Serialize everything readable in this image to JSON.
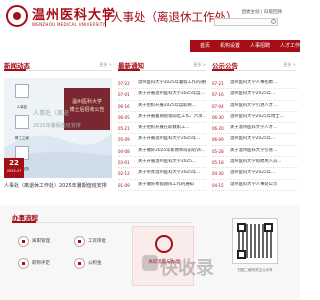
{
  "header": {
    "logo_name": "温州医科大学",
    "logo_en": "WENZHOU MEDICAL UNIVERSITY",
    "dept_title": "人事处（离退休工作处）",
    "top_links": "团委主站 | 旧版回顾"
  },
  "nav": {
    "items": [
      "首页",
      "机构设置",
      "人事招聘",
      "人才工作",
      "博士后工作"
    ]
  },
  "sections": {
    "photo_news": {
      "title": "新闻动态",
      "more": "更多 >"
    },
    "latest_news": {
      "title": "最新通知",
      "more": "更多 >"
    },
    "announcements": {
      "title": "公示公告",
      "more": "更多 >"
    },
    "process": {
      "title": "办事流程"
    }
  },
  "carousel": {
    "side_items": [
      "人事处",
      "教工之家",
      "人才服务"
    ],
    "banner_line1": "温州医科大学",
    "banner_line2": "博士后招收公告",
    "overlay_line1": "人事处（离退",
    "overlay_line2": "2025年暑假值班安排",
    "day": "22",
    "year_month": "2025-07",
    "caption": "人事处（离退休工作处）2025年暑期值班安排"
  },
  "news": [
    {
      "date": "07-22",
      "text": "温州医科大学2025年暑假工作的通知"
    },
    {
      "date": "07-01",
      "text": "关于开展温州医科大学2025年度…"
    },
    {
      "date": "06-16",
      "text": "关于组织开展2025年度职称…"
    },
    {
      "date": "06-05",
      "text": "关于开展暑期管理岗位工作、六项…"
    },
    {
      "date": "05-21",
      "text": "关于组织开展在职教职工…"
    },
    {
      "date": "05-09",
      "text": "关于开展温州医科大学2025年…"
    },
    {
      "date": "04-08",
      "text": "关于做好2025年新教师岗前培训…"
    },
    {
      "date": "03-01",
      "text": "关于开展温州医科大学2025…"
    },
    {
      "date": "02-12",
      "text": "关于举办温州医科大学2025年…"
    },
    {
      "date": "01-09",
      "text": "关于做好寒假期间工作的通知"
    }
  ],
  "announcements": [
    {
      "date": "07-21",
      "text": "温州医科大学人事招聘…"
    },
    {
      "date": "07-16",
      "text": "温州医科大学2025年…"
    },
    {
      "date": "07-04",
      "text": "温州医科大学引进人才…"
    },
    {
      "date": "06-30",
      "text": "温州医科大学2025年博士…"
    },
    {
      "date": "06-20",
      "text": "关于温州医科大学人才…"
    },
    {
      "date": "06-09",
      "text": "温州医科大学2025年…"
    },
    {
      "date": "05-28",
      "text": "关于温州医科大学引进…"
    },
    {
      "date": "05-18",
      "text": "温州医科大学拟聘用人员…"
    },
    {
      "date": "04-30",
      "text": "温州医科大学2025年…"
    },
    {
      "date": "04-15",
      "text": "温州医科大学人事处公示"
    }
  ],
  "process": {
    "items": [
      "离职管理",
      "工资审批",
      "职称评定",
      "公积金"
    ],
    "highlight": "离职流程与办理"
  },
  "qr": {
    "caption": "扫描二维码关注公众号"
  },
  "watermark": "快收录"
}
